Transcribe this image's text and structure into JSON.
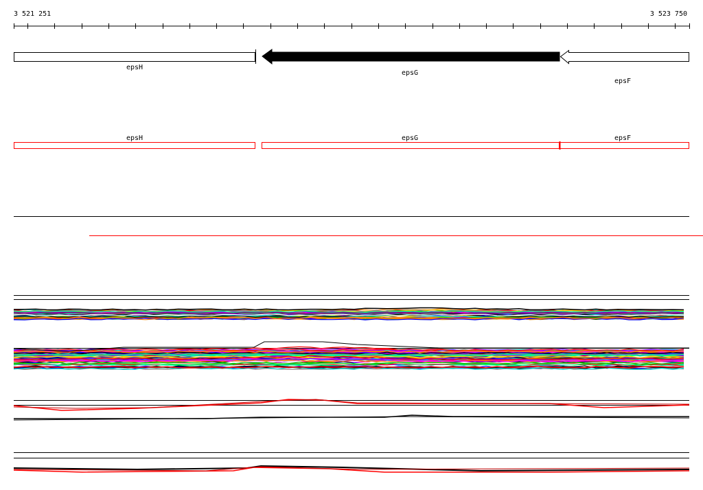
{
  "ruler": {
    "start_label": "3 521 251",
    "end_label": "3 523 750",
    "start": 3521251,
    "end": 3523750
  },
  "genes": {
    "epsH": "epsH",
    "epsG": "epsG",
    "epsF": "epsF"
  },
  "colors": {
    "gene_track": "#000000",
    "annotation_track": "#ff0000",
    "selected_gene_fill": "#000000",
    "divider": "#000000"
  },
  "expression_palette": [
    "#ff0000",
    "#00c800",
    "#0000ff",
    "#ff00ff",
    "#00d0d0",
    "#ffd000",
    "#8000ff",
    "#ff8000",
    "#000000",
    "#ffffff",
    "#808080",
    "#00ff80"
  ],
  "track_styles": {
    "group_a": "multicolor",
    "group_b": "multicolor",
    "group_c": "black-red",
    "group_d": "black",
    "group_e": "black-red"
  }
}
